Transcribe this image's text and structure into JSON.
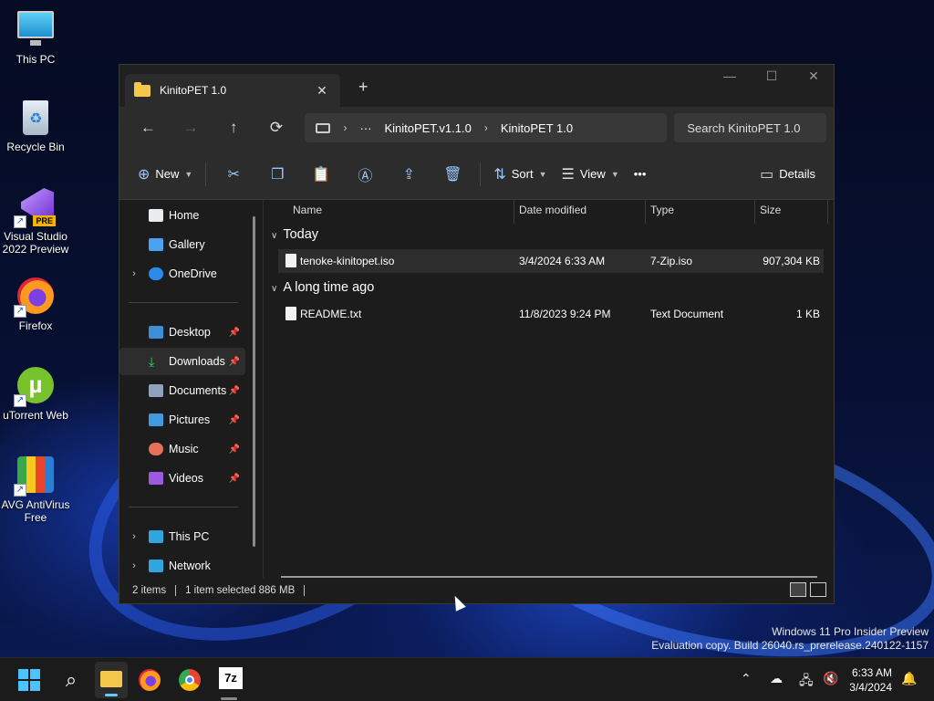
{
  "desktop": {
    "icons": [
      {
        "label": "This PC"
      },
      {
        "label": "Recycle Bin"
      },
      {
        "label": "Visual Studio 2022 Preview",
        "badge": "PRE"
      },
      {
        "label": "Firefox"
      },
      {
        "label": "uTorrent Web"
      },
      {
        "label": "AVG AntiVirus Free"
      }
    ]
  },
  "window": {
    "tab_title": "KinitoPET 1.0",
    "tab_close": "✕",
    "new_tab": "+",
    "controls": {
      "minimize": "—",
      "maximize": "☐",
      "close": "✕"
    },
    "nav": {
      "back": "←",
      "forward": "→",
      "up": "↑",
      "refresh": "⟳"
    },
    "breadcrumb": {
      "more": "···",
      "segments": [
        "KinitoPET.v1.1.0",
        "KinitoPET 1.0"
      ]
    },
    "search_placeholder": "Search KinitoPET 1.0",
    "commands": {
      "new": "New",
      "sort": "Sort",
      "view": "View",
      "more": "•••",
      "details": "Details"
    },
    "sidebar": {
      "home": "Home",
      "gallery": "Gallery",
      "onedrive": "OneDrive",
      "desktop": "Desktop",
      "downloads": "Downloads",
      "documents": "Documents",
      "pictures": "Pictures",
      "music": "Music",
      "videos": "Videos",
      "this_pc": "This PC",
      "network": "Network"
    },
    "columns": {
      "name": "Name",
      "date": "Date modified",
      "type": "Type",
      "size": "Size"
    },
    "groups": [
      {
        "title": "Today",
        "files": [
          {
            "name": "tenoke-kinitopet.iso",
            "date": "3/4/2024 6:33 AM",
            "type": "7-Zip.iso",
            "size": "907,304 KB",
            "selected": true
          }
        ]
      },
      {
        "title": "A long time ago",
        "files": [
          {
            "name": "README.txt",
            "date": "11/8/2023 9:24 PM",
            "type": "Text Document",
            "size": "1 KB",
            "selected": false
          }
        ]
      }
    ],
    "status": {
      "count": "2 items",
      "selection": "1 item selected  886 MB"
    }
  },
  "watermark": {
    "line1": "Windows 11 Pro Insider Preview",
    "line2": "Evaluation copy. Build 26040.rs_prerelease.240122-1157"
  },
  "taskbar": {
    "time": "6:33 AM",
    "date": "3/4/2024",
    "seven_zip_label": "7z"
  },
  "colors": {
    "accent": "#60cdff",
    "folder": "#f5c84c",
    "selected_row": "#2d2d2d"
  }
}
